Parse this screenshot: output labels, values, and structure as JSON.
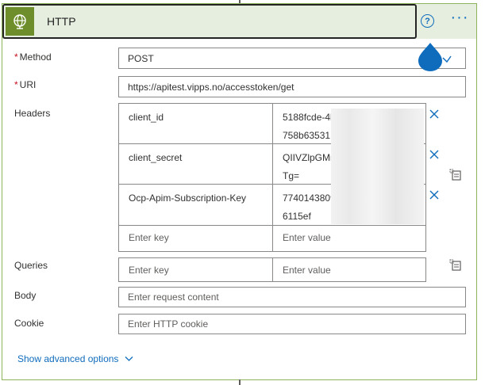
{
  "action": {
    "title": "HTTP",
    "icon": "globe-icon",
    "brand_color": "#6e8e2b",
    "help_label": "?",
    "more_label": "···"
  },
  "fields": {
    "method": {
      "label": "Method",
      "required": true,
      "value": "POST"
    },
    "uri": {
      "label": "URI",
      "required": true,
      "value": "https://apitest.vipps.no/accesstoken/get"
    },
    "headers": {
      "label": "Headers",
      "rows": [
        {
          "key": "client_id",
          "value_line1": "5188fcde-4b",
          "value_line2": "758b63531"
        },
        {
          "key": "client_secret",
          "value_line1": "QIIVZlpGMn",
          "value_line2": "Tg="
        },
        {
          "key": "Ocp-Apim-Subscription-Key",
          "value_line1": "7740143809",
          "value_line2": "6115ef"
        }
      ],
      "key_placeholder": "Enter key",
      "value_placeholder": "Enter value"
    },
    "queries": {
      "label": "Queries",
      "key_placeholder": "Enter key",
      "value_placeholder": "Enter value"
    },
    "body": {
      "label": "Body",
      "placeholder": "Enter request content"
    },
    "cookie": {
      "label": "Cookie",
      "placeholder": "Enter HTTP cookie"
    }
  },
  "advanced_options_label": "Show advanced options",
  "colors": {
    "accent": "#0f6cbd",
    "required": "#c50f1f",
    "header_bg": "#e6efdf",
    "border_success": "#8fb35a"
  }
}
